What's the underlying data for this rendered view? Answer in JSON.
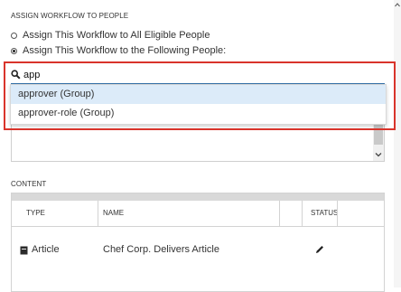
{
  "assign_section": {
    "heading": "ASSIGN WORKFLOW TO PEOPLE",
    "options": [
      {
        "label": "Assign This Workflow to All Eligible People",
        "checked": false
      },
      {
        "label": "Assign This Workflow to the Following People:",
        "checked": true
      }
    ]
  },
  "search": {
    "value": "app",
    "icon": "search-icon"
  },
  "suggestions": [
    {
      "label": "approver (Group)",
      "active": true
    },
    {
      "label": "approver-role (Group)",
      "active": false
    }
  ],
  "content_section": {
    "heading": "CONTENT",
    "columns": [
      "TYPE",
      "NAME",
      "STATUS"
    ],
    "rows": [
      {
        "type_icon": "document-icon",
        "type": "Article",
        "name": "Chef Corp. Delivers Article",
        "status_icon": "pencil-icon"
      }
    ]
  },
  "colors": {
    "highlight": "#d9342b",
    "active_suggestion": "#dcebf9",
    "input_underline": "#2f6fa8"
  }
}
